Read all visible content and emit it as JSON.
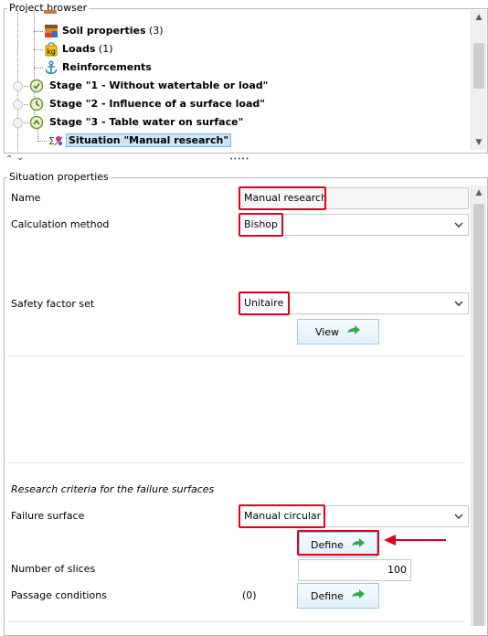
{
  "project_browser": {
    "title": "Project browser",
    "items": [
      {
        "label": "Soil properties",
        "count": "(3)"
      },
      {
        "label": "Loads",
        "count": "(1)"
      },
      {
        "label": "Reinforcements",
        "count": ""
      },
      {
        "label": "Stage \"1 - Without watertable or load\"",
        "count": ""
      },
      {
        "label": "Stage \"2 - Influence of a surface load\"",
        "count": ""
      },
      {
        "label": "Stage \"3 - Table water on surface\"",
        "count": ""
      },
      {
        "label": "Situation \"Manual research\"",
        "count": ""
      }
    ]
  },
  "splitter": {
    "collapse_up": "⌃",
    "collapse_down": "⌄",
    "grip": "• • • • •"
  },
  "situation": {
    "title": "Situation properties",
    "name_label": "Name",
    "name_value": "Manual research",
    "calc_label": "Calculation method",
    "calc_value": "Bishop",
    "safety_label": "Safety factor set",
    "safety_value": "Unitaire",
    "view_button": "View",
    "research_heading": "Research criteria for the failure surfaces",
    "failure_label": "Failure surface",
    "failure_value": "Manual circular",
    "define_button": "Define",
    "slices_label": "Number of slices",
    "slices_value": "100",
    "passage_label": "Passage conditions",
    "passage_count": "(0)",
    "passage_button": "Define"
  },
  "colors": {
    "highlight": "#e0001b",
    "selection": "#cce4f7",
    "button_arrow": "#2fa84f"
  },
  "icons": [
    "soil-properties-icon",
    "loads-icon",
    "anchor-icon",
    "stage-icon",
    "situation-icon",
    "green-arrow-icon",
    "chevron-down-icon",
    "red-arrow-icon"
  ]
}
